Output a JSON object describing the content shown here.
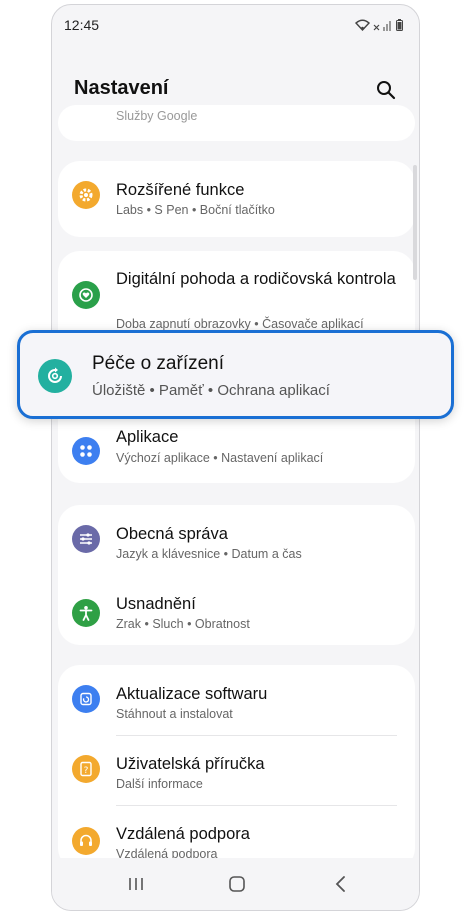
{
  "status_bar": {
    "time": "12:45"
  },
  "header": {
    "title": "Nastavení"
  },
  "partial_item": {
    "subtitle": "Služby Google"
  },
  "items": [
    {
      "title": "Rozšířené funkce",
      "subtitle": "Labs  •  S Pen  •  Boční tlačítko",
      "icon": "gear-icon",
      "color": "#f3a92e"
    },
    {
      "title": "Digitální pohoda a rodičovská kontrola",
      "subtitle": "Doba zapnutí obrazovky  •  Časovače aplikací",
      "icon": "heart-circle-icon",
      "color": "#2aa04a"
    },
    {
      "title": "Péče o zařízení",
      "subtitle": "Úložiště  •  Paměť  •  Ochrana aplikací",
      "icon": "device-care-icon",
      "color": "#23b0a0"
    },
    {
      "title": "Aplikace",
      "subtitle": "Výchozí aplikace  •  Nastavení aplikací",
      "icon": "apps-grid-icon",
      "color": "#3d7ff0"
    },
    {
      "title": "Obecná správa",
      "subtitle": "Jazyk a klávesnice  •  Datum a čas",
      "icon": "sliders-icon",
      "color": "#6a6aa8"
    },
    {
      "title": "Usnadnění",
      "subtitle": "Zrak  •  Sluch  •  Obratnost",
      "icon": "accessibility-icon",
      "color": "#2fa045"
    },
    {
      "title": "Aktualizace softwaru",
      "subtitle": "Stáhnout a instalovat",
      "icon": "update-icon",
      "color": "#3d7ff0"
    },
    {
      "title": "Uživatelská příručka",
      "subtitle": "Další informace",
      "icon": "manual-icon",
      "color": "#f3a92e"
    },
    {
      "title": "Vzdálená podpora",
      "subtitle": "Vzdálená podpora",
      "icon": "headset-icon",
      "color": "#f3a92e"
    }
  ]
}
